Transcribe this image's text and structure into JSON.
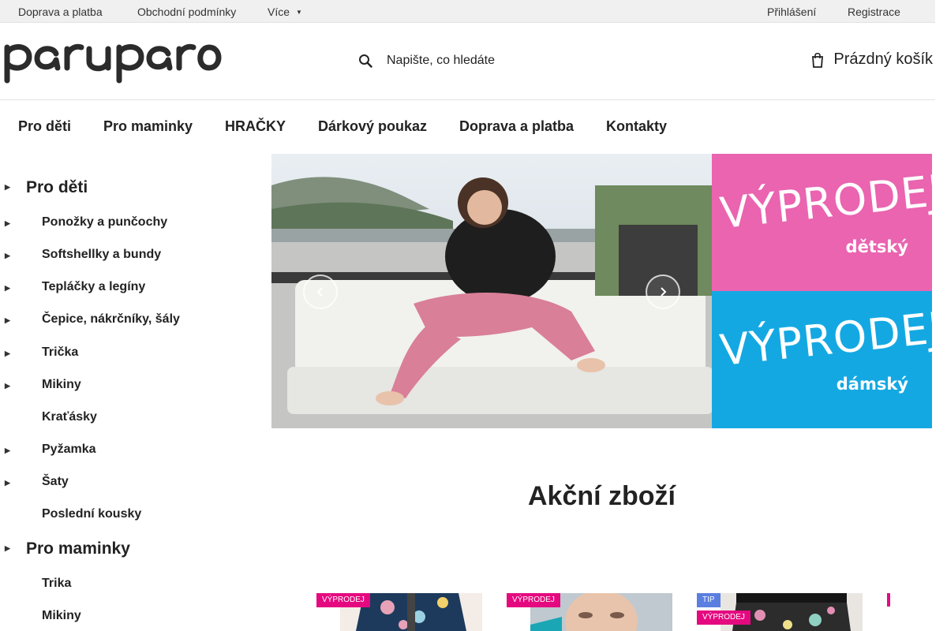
{
  "topbar": {
    "links": [
      "Doprava a platba",
      "Obchodní podmínky",
      "Více"
    ],
    "login": "Přihlášení",
    "register": "Registrace"
  },
  "header": {
    "logo_text": "paruparo",
    "search_placeholder": "Napište, co hledáte",
    "cart_label": "Prázdný košík"
  },
  "mainnav": [
    "Pro děti",
    "Pro maminky",
    "HRAČKY",
    "Dárkový poukaz",
    "Doprava a platba",
    "Kontakty"
  ],
  "sidebar": {
    "kids": {
      "label": "Pro děti",
      "items": [
        "Ponožky a punčochy",
        "Softshellky a bundy",
        "Tepláčky a legíny",
        "Čepice, nákrčníky, šály",
        "Trička",
        "Mikiny",
        "Kraťásky",
        "Pyžamka",
        "Šaty",
        "Poslední kousky"
      ]
    },
    "moms": {
      "label": "Pro maminky",
      "items": [
        "Trika",
        "Mikiny"
      ]
    }
  },
  "promos": {
    "kids": {
      "big": "VÝPRODEJ",
      "small": "dětský",
      "color": "#ea64b0"
    },
    "women": {
      "big": "VÝPRODEJ",
      "small": "dámský",
      "color": "#14a8e3"
    }
  },
  "section": {
    "title": "Akční zboží"
  },
  "products": [
    {
      "badges": [
        "VÝPRODEJ"
      ]
    },
    {
      "badges": [
        "VÝPRODEJ"
      ]
    },
    {
      "badges": [
        "TIP",
        "VÝPRODEJ"
      ]
    }
  ],
  "colors": {
    "accent_pink": "#e5097f",
    "tip_blue": "#5a7fe0"
  }
}
